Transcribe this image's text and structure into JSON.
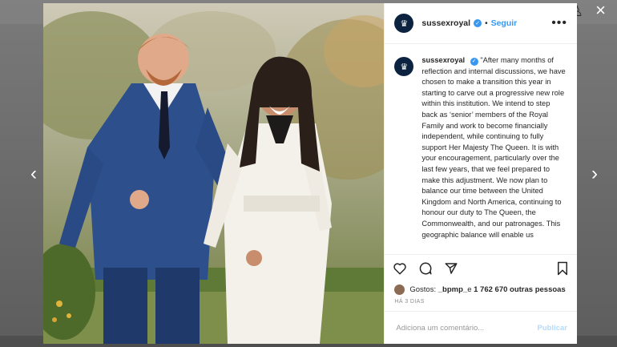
{
  "post": {
    "username": "sussexroyal",
    "follow_label": "Seguir",
    "dot": "•",
    "more_label": "•••",
    "avatar_glyph": "♛",
    "caption": "\"After many months of reflection and internal discussions, we have chosen to make a transition this year in starting to carve out a progressive new role within this institution. We intend to step back as ‘senior’ members of the Royal Family and work to become financially independent, while continuing to fully support Her Majesty The Queen. It is with your encouragement, particularly over the last few years, that we feel prepared to make this adjustment. We now plan to balance our time between the United Kingdom and North America, continuing to honour our duty to The Queen, the Commonwealth, and our patronages. This geographic balance will enable us",
    "likes_prefix": "Gostos: ",
    "likes_user": "_bpmp_",
    "likes_mid": " e ",
    "likes_count": "1 762 670 outras pessoas",
    "time_ago": "HÁ 3 DIAS",
    "comment_placeholder": "Adiciona um comentário...",
    "publish_label": "Publicar"
  },
  "icons": {
    "close": "×",
    "prev": "‹",
    "next": "›",
    "verified": "✓",
    "bg_profile": "♙",
    "heart": "heart-icon",
    "comment": "comment-icon",
    "share": "share-icon",
    "bookmark": "bookmark-icon"
  },
  "colors": {
    "accent": "#3897f0",
    "avatar_bg": "#0b2341",
    "publish_disabled": "#b3dbff"
  }
}
